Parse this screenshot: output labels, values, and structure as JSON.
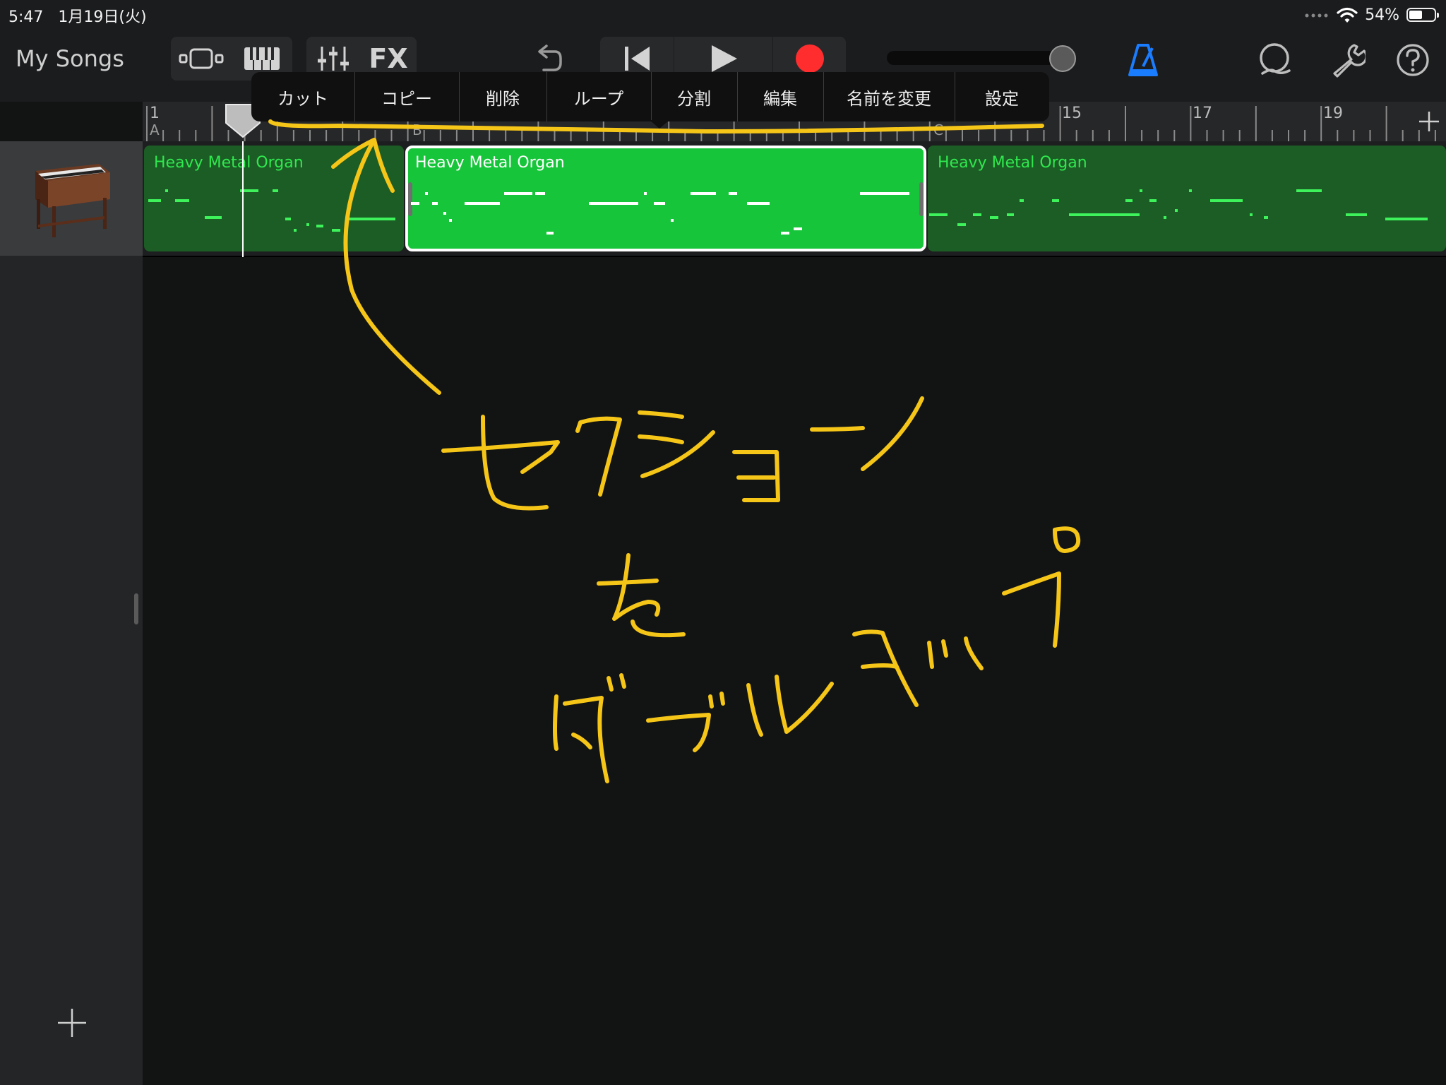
{
  "status_bar": {
    "time": "5:47",
    "date": "1月19日(火)",
    "battery_percent": "54%",
    "battery_level": 0.54
  },
  "toolbar": {
    "my_songs": "My Songs",
    "fx_label": "FX",
    "accent_color": "#1a7cff",
    "record_color": "#ff2d2d",
    "volume_level": 0.93
  },
  "ruler": {
    "bars": [
      "1",
      "15",
      "17",
      "19"
    ],
    "sections": [
      "A",
      "B",
      "C"
    ]
  },
  "track": {
    "instrument": "Heavy Metal Organ",
    "regions": [
      {
        "label": "Heavy Metal Organ",
        "selected": false
      },
      {
        "label": "Heavy Metal Organ",
        "selected": true
      },
      {
        "label": "Heavy Metal Organ",
        "selected": false
      }
    ]
  },
  "context_menu": {
    "items": [
      "カット",
      "コピー",
      "削除",
      "ループ",
      "分割",
      "編集",
      "名前を変更",
      "設定"
    ]
  },
  "annotation": {
    "text_lines": [
      "セクション",
      "を",
      "ダブルタップ"
    ],
    "color": "#f5c518"
  },
  "icons": [
    "tracks-view-icon",
    "keyboard-icon",
    "mixer-icon",
    "undo-icon",
    "go-to-start-icon",
    "play-icon",
    "record-icon",
    "metronome-icon",
    "loop-icon",
    "wrench-icon",
    "help-icon",
    "add-section-icon",
    "add-track-icon",
    "wifi-icon",
    "signal-dots-icon",
    "battery-icon"
  ]
}
